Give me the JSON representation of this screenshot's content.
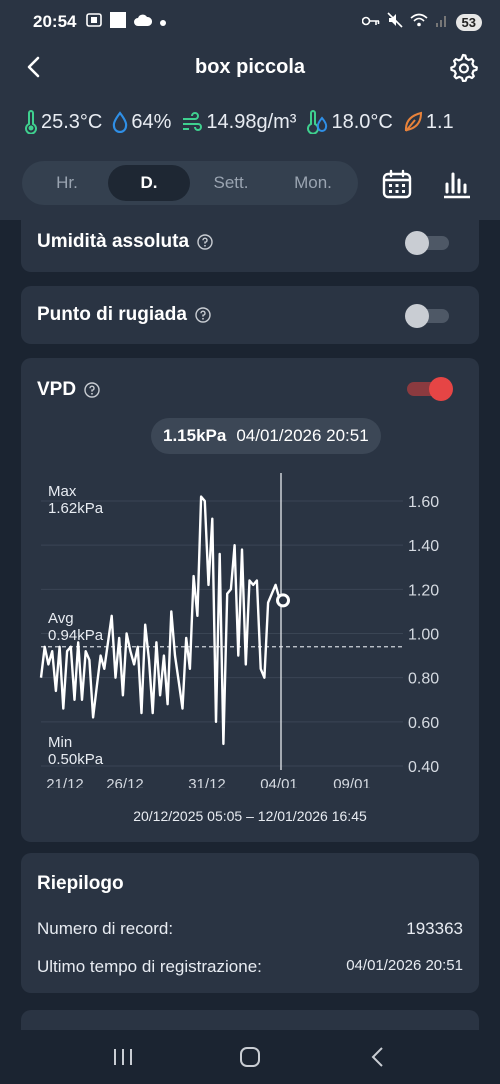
{
  "status_bar": {
    "time": "20:54",
    "battery": "53"
  },
  "header": {
    "title": "box piccola"
  },
  "readings": [
    {
      "icon": "thermometer-icon",
      "value": "25.3°C",
      "color": "#3fd08f"
    },
    {
      "icon": "water-drop-icon",
      "value": "64%",
      "color": "#2f8fe6"
    },
    {
      "icon": "wind-icon",
      "value": "14.98g/m³",
      "color": "#3fd08f"
    },
    {
      "icon": "dew-point-icon",
      "value": "18.0°C",
      "color": "#3fd08f"
    },
    {
      "icon": "leaf-icon",
      "value": "1.1",
      "color": "#e8823a"
    }
  ],
  "tabs": [
    {
      "label": "Hr.",
      "active": false
    },
    {
      "label": "D.",
      "active": true
    },
    {
      "label": "Sett.",
      "active": false
    },
    {
      "label": "Mon.",
      "active": false
    }
  ],
  "metrics": [
    {
      "label": "Umidità assoluta",
      "enabled": false
    },
    {
      "label": "Punto di rugiada",
      "enabled": false
    }
  ],
  "vpd": {
    "label": "VPD",
    "enabled": true,
    "tooltip_value": "1.15kPa",
    "tooltip_time": "04/01/2026 20:51",
    "max_label": "Max",
    "max_value": "1.62kPa",
    "avg_label": "Avg",
    "avg_value": "0.94kPa",
    "min_label": "Min",
    "min_value": "0.50kPa",
    "range_text": "20/12/2025 05:05 – 12/01/2026 16:45"
  },
  "chart_data": {
    "type": "line",
    "series_color": "#ffffff",
    "x_labels": [
      "21/12",
      "26/12",
      "31/12",
      "04/01",
      "09/01"
    ],
    "y_ticks": [
      "1.60",
      "1.40",
      "1.20",
      "1.00",
      "0.80",
      "0.60",
      "0.40"
    ],
    "ylim": [
      0.4,
      1.7
    ],
    "avg": 0.94,
    "cursor_index": 59,
    "values": [
      0.8,
      0.94,
      0.86,
      0.92,
      0.74,
      0.94,
      0.66,
      0.92,
      0.94,
      0.7,
      0.96,
      0.7,
      0.92,
      0.88,
      0.62,
      0.76,
      0.9,
      0.84,
      0.96,
      1.08,
      0.8,
      0.98,
      0.72,
      1.0,
      0.92,
      0.86,
      0.94,
      0.64,
      1.04,
      0.88,
      0.64,
      0.96,
      0.72,
      0.9,
      0.68,
      1.1,
      0.9,
      0.78,
      0.66,
      0.98,
      0.84,
      1.26,
      1.08,
      1.62,
      1.6,
      1.22,
      1.52,
      0.6,
      1.36,
      0.5,
      1.18,
      1.2,
      1.4,
      0.9,
      1.38,
      0.86,
      1.24,
      1.22,
      1.24,
      0.84,
      0.8,
      1.14,
      1.18,
      1.22,
      1.16,
      1.15
    ]
  },
  "summary": {
    "title": "Riepilogo",
    "records_label": "Numero di record:",
    "records_value": "193363",
    "last_time_label": "Ultimo tempo di registrazione:",
    "last_time_value": "04/01/2026 20:51"
  }
}
